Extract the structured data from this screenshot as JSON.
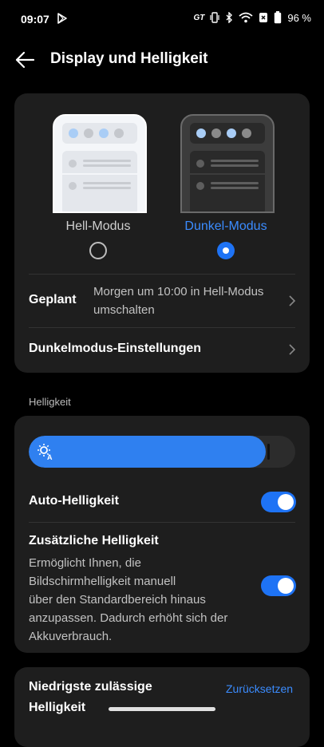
{
  "status_bar": {
    "time": "09:07",
    "gt_label": "GT",
    "battery": "96 %"
  },
  "header": {
    "title": "Display und Helligkeit"
  },
  "theme_card": {
    "light_label": "Hell-Modus",
    "dark_label": "Dunkel-Modus",
    "selected": "dark",
    "scheduled_title": "Geplant",
    "scheduled_desc_line1": "Morgen um 10:00  in Hell-Modus",
    "scheduled_desc_line2": "umschalten",
    "dark_settings_label": "Dunkelmodus-Einstellungen"
  },
  "brightness_section": {
    "label": "Helligkeit",
    "level": 0.89,
    "auto_label": "Auto-Helligkeit",
    "auto_on": true,
    "extra_title": "Zusätzliche Helligkeit",
    "extra_desc": [
      "Ermöglicht Ihnen, die",
      "Bildschirmhelligkeit manuell",
      "über den Standardbereich hinaus",
      "anzupassen. Dadurch erhöht sich der",
      "Akkuverbrauch."
    ],
    "extra_on": true
  },
  "min_brightness": {
    "title_line1": "Niedrigste zulässige",
    "title_line2": "Helligkeit",
    "reset_label": "Zurücksetzen"
  },
  "colors": {
    "accent": "#1e73f5",
    "accent_text": "#3b8cff",
    "card": "#1e1e1e",
    "background": "#000000"
  }
}
